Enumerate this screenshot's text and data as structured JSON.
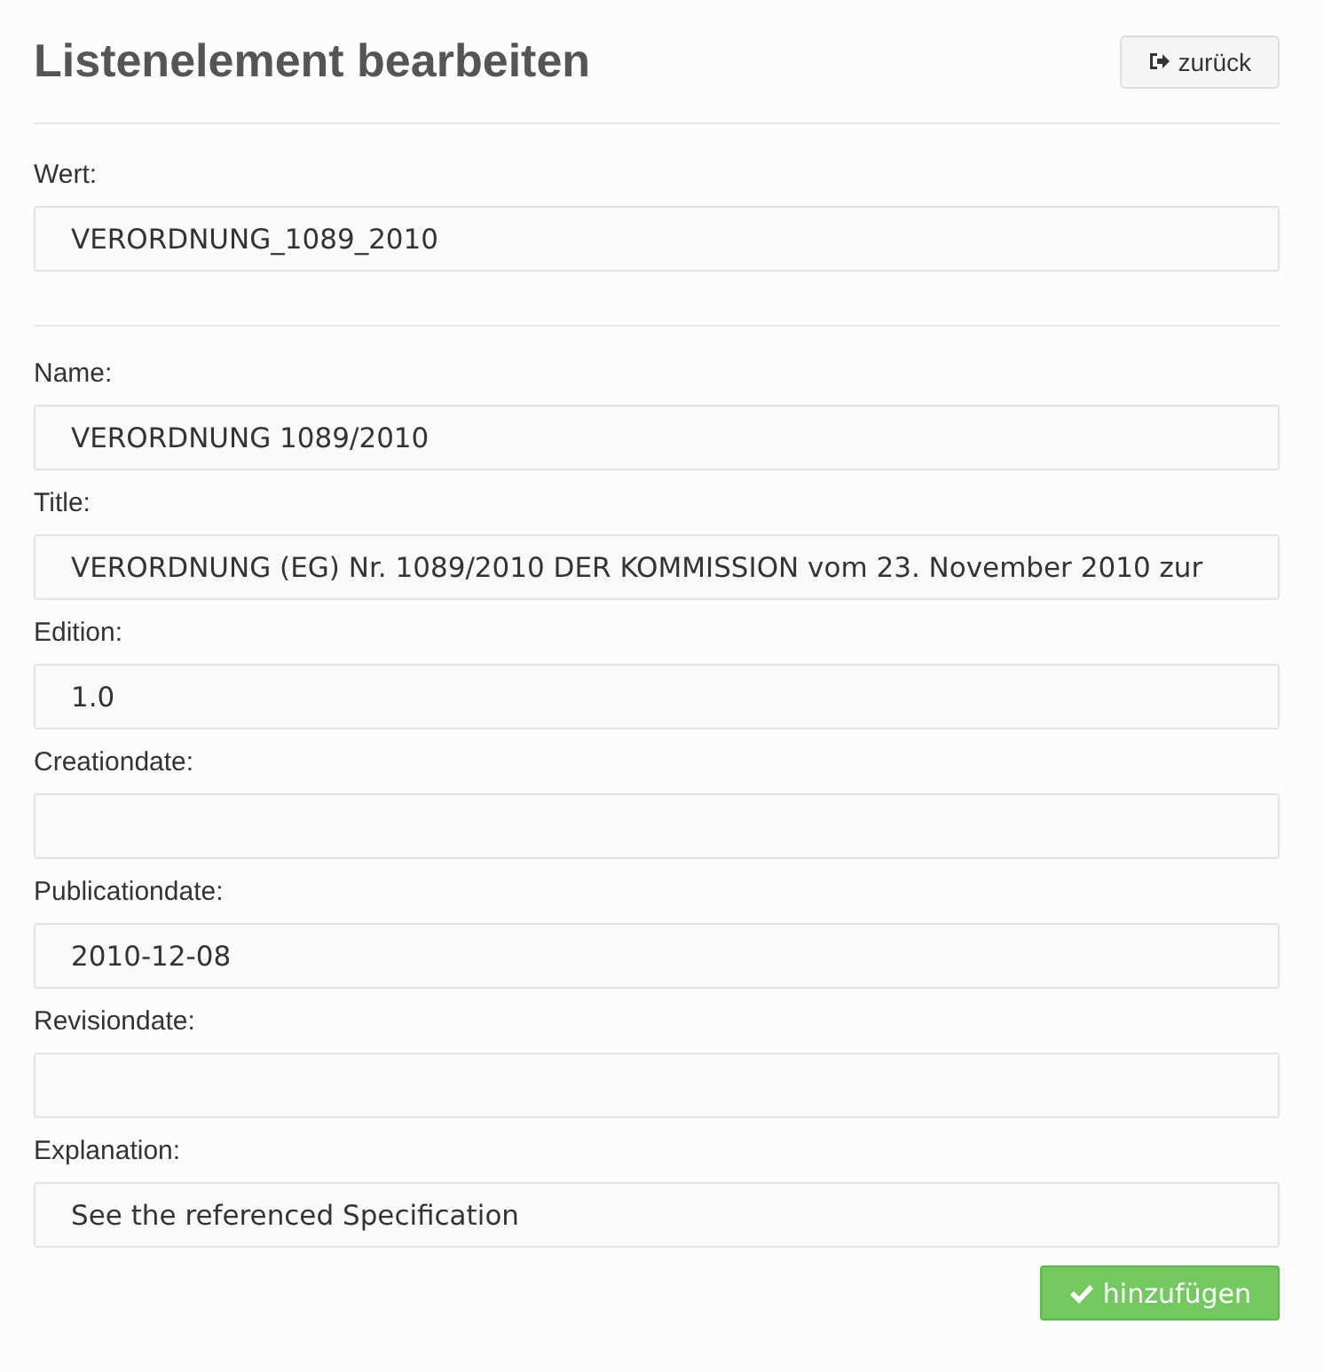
{
  "title": "Listenelement bearbeiten",
  "back_button": {
    "label": "zurück"
  },
  "sections": [
    {
      "fields": [
        {
          "label": "Wert:",
          "value": "VERORDNUNG_1089_2010"
        }
      ]
    },
    {
      "fields": [
        {
          "label": "Name:",
          "value": "VERORDNUNG 1089/2010"
        },
        {
          "label": "Title:",
          "value": "VERORDNUNG (EG) Nr. 1089/2010 DER KOMMISSION vom 23. November 2010 zur"
        },
        {
          "label": "Edition:",
          "value": "1.0"
        },
        {
          "label": "Creationdate:"
        },
        {
          "label": "Publicationdate:",
          "value": "2010-12-08"
        },
        {
          "label": "Revisiondate:"
        },
        {
          "label": "Explanation:",
          "value": "See the referenced Specification"
        }
      ]
    }
  ],
  "submit_button": {
    "label": "hinzufügen"
  }
}
